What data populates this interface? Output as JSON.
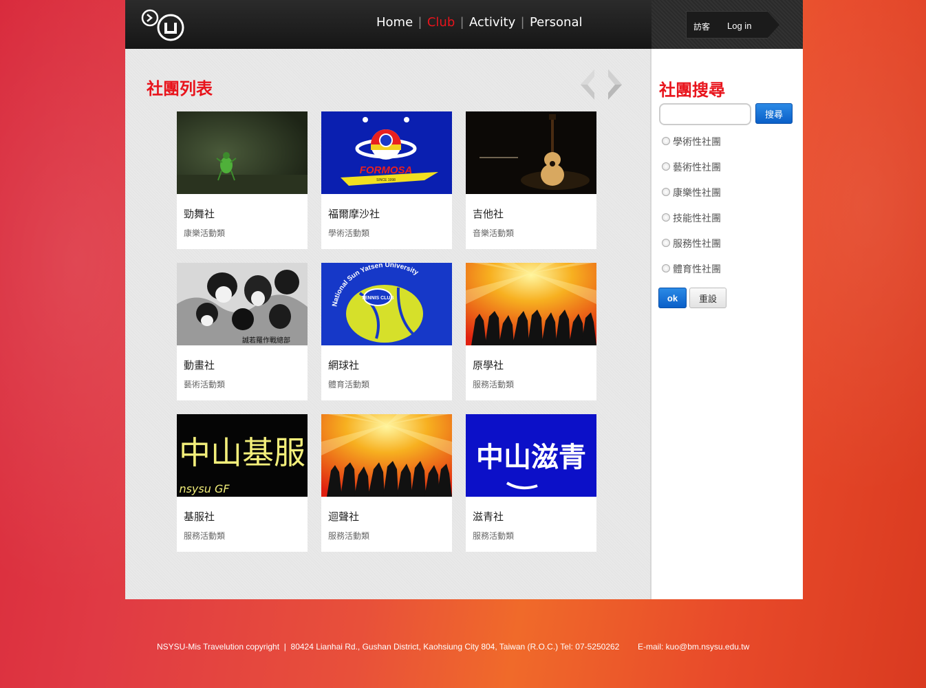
{
  "header": {
    "nav": [
      {
        "label": "Home",
        "active": false
      },
      {
        "label": "Club",
        "active": true
      },
      {
        "label": "Activity",
        "active": false
      },
      {
        "label": "Personal",
        "active": false
      }
    ],
    "user_label": "訪客",
    "login_label": "Log in"
  },
  "main": {
    "title": "社團列表",
    "clubs": [
      {
        "name": "勁舞社",
        "category": "康樂活動類",
        "image": "green-beetle-photo"
      },
      {
        "name": "福爾摩沙社",
        "category": "學術活動類",
        "image": "formosa-logo-blue"
      },
      {
        "name": "吉他社",
        "category": "音樂活動類",
        "image": "acoustic-guitar-photo"
      },
      {
        "name": "動畫社",
        "category": "藝術活動類",
        "image": "anime-characters-sketch"
      },
      {
        "name": "網球社",
        "category": "體育活動類",
        "image": "tennis-club-logo"
      },
      {
        "name": "原學社",
        "category": "服務活動類",
        "image": "dancing-silhouettes-sunburst"
      },
      {
        "name": "基服社",
        "category": "服務活動類",
        "image": "yellow-calligraphy-black"
      },
      {
        "name": "迴聲社",
        "category": "服務活動類",
        "image": "dancing-silhouettes-sunburst"
      },
      {
        "name": "滋青社",
        "category": "服務活動類",
        "image": "white-calligraphy-blue"
      }
    ],
    "thumb_text": {
      "formosa": "FORMOSA",
      "formosa_since": "SINCE 1998",
      "tennis_arc": "National Sun Yatsen University",
      "tennis_club": "TENNIS CLUB",
      "jifu_chars": "中山基服",
      "jifu_latin": "nsysu GF",
      "ziqing_chars": "中山滋青",
      "anime_caption": "誠若羅作戰總部"
    }
  },
  "sidebar": {
    "title": "社團搜尋",
    "search_value": "",
    "search_button": "搜尋",
    "filters": [
      "學術性社團",
      "藝術性社團",
      "康樂性社團",
      "技能性社團",
      "服務性社團",
      "體育性社團"
    ],
    "ok_label": "ok",
    "reset_label": "重設"
  },
  "footer": {
    "text": "NSYSU-Mis Travelution copyright  |  80424 Lianhai Rd., Gushan District, Kaohsiung City 804, Taiwan (R.O.C.) Tel: 07-5250262        E-mail: kuo@bm.nsysu.edu.tw"
  },
  "colors": {
    "accent_red": "#e8141c",
    "button_blue": "#0a5fc8",
    "header_dark": "#1f1f1f"
  }
}
